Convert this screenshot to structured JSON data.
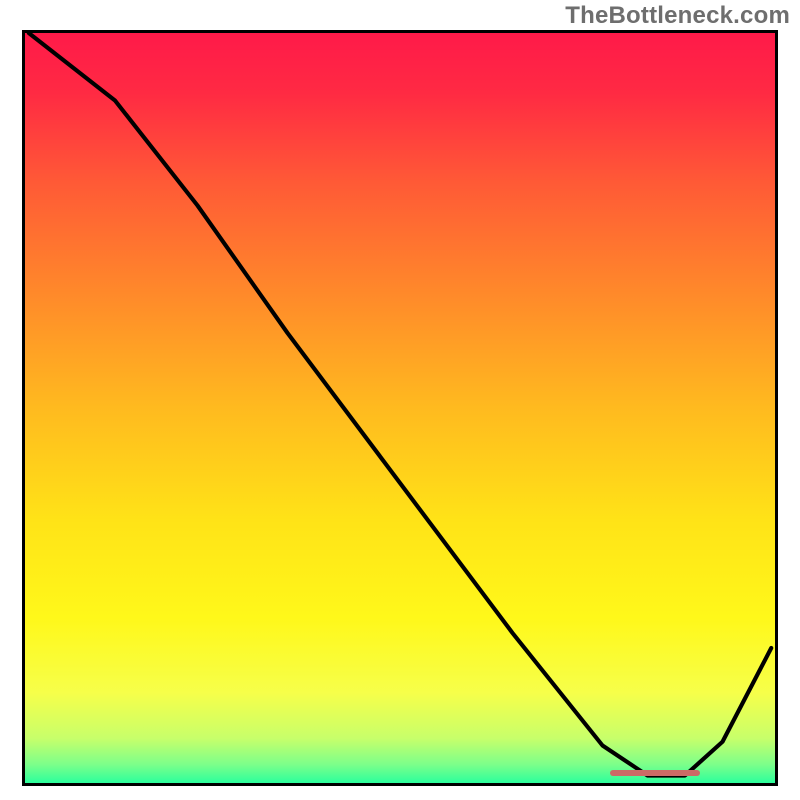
{
  "watermark": "TheBottleneck.com",
  "chart_data": {
    "type": "line",
    "title": "",
    "xlabel": "",
    "ylabel": "",
    "xlim": [
      0,
      100
    ],
    "ylim": [
      0,
      100
    ],
    "gradient_stops": [
      {
        "offset": 0.0,
        "color": "#ff1a49"
      },
      {
        "offset": 0.08,
        "color": "#ff2a43"
      },
      {
        "offset": 0.2,
        "color": "#ff5a36"
      },
      {
        "offset": 0.35,
        "color": "#ff8a2a"
      },
      {
        "offset": 0.5,
        "color": "#ffba1f"
      },
      {
        "offset": 0.65,
        "color": "#ffe317"
      },
      {
        "offset": 0.78,
        "color": "#fff81a"
      },
      {
        "offset": 0.88,
        "color": "#f6ff4a"
      },
      {
        "offset": 0.94,
        "color": "#c8ff6a"
      },
      {
        "offset": 0.975,
        "color": "#7dff8a"
      },
      {
        "offset": 1.0,
        "color": "#2cff9c"
      }
    ],
    "series": [
      {
        "name": "bottleneck-curve",
        "x": [
          0.5,
          12,
          23,
          35,
          50,
          65,
          77,
          83,
          88,
          93,
          99.5
        ],
        "y": [
          100,
          91,
          77,
          60,
          40,
          20,
          5,
          1.0,
          1.0,
          5.5,
          18
        ]
      }
    ],
    "marker": {
      "name": "optimal-range",
      "x0": 78,
      "x1": 90,
      "y": 1.4,
      "color": "#cc6b66"
    }
  }
}
